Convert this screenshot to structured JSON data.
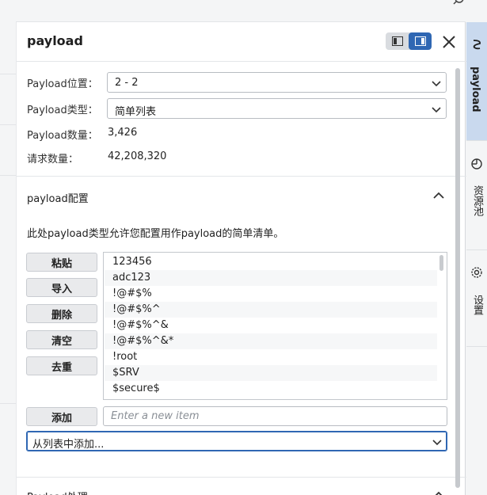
{
  "panel": {
    "title": "payload",
    "layout_options": [
      "layout-left-icon",
      "layout-right-icon"
    ],
    "close_icon": "close-icon"
  },
  "info": {
    "position_label": "Payload位置：",
    "position_value": "2 - 2",
    "type_label": "Payload类型：",
    "type_value": "简单列表",
    "count_label": "Payload数量：",
    "count_value": "3,426",
    "requests_label": "请求数量：",
    "requests_value": "42,208,320"
  },
  "config": {
    "title": "payload配置",
    "description": "此处payload类型允许您配置用作payload的简单清单。",
    "buttons": {
      "paste": "粘贴",
      "load": "导入",
      "remove": "删除",
      "clear": "清空",
      "dedupe": "去重",
      "add": "添加"
    },
    "items": [
      "123456",
      "adc123",
      "!@#$%",
      "!@#$%^",
      "!@#$%^&",
      "!@#$%^&*",
      "!root",
      "$SRV",
      "$secure$"
    ],
    "new_item_placeholder": "Enter a new item",
    "add_from_list": "从列表中添加..."
  },
  "next_section": {
    "title": "Payload处理"
  },
  "rail": {
    "items": [
      {
        "label": "payload",
        "icon": "payload-icon",
        "active": true
      },
      {
        "label": "资源池",
        "icon": "resource-pool-icon",
        "active": false
      },
      {
        "label": "设置",
        "icon": "gear-icon",
        "active": false
      }
    ]
  },
  "colors": {
    "accent": "#2f67b3",
    "rail_active": "#c9d9ee"
  }
}
